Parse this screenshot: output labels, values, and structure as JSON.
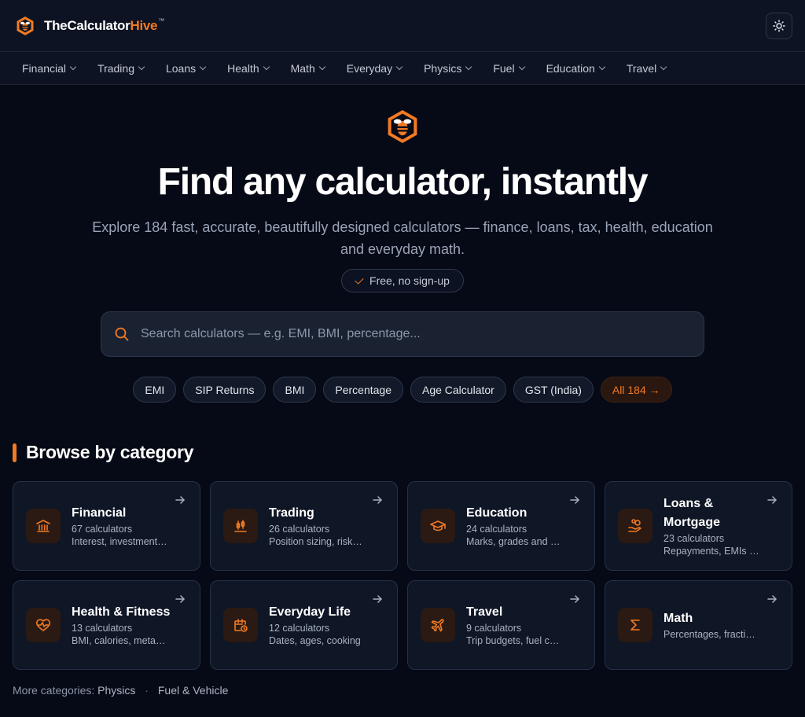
{
  "brand": {
    "name_part1": "TheCalculator",
    "name_part2": "Hive",
    "trademark": "™"
  },
  "theme_toggle_icon": "sun-icon",
  "nav": [
    {
      "label": "Financial"
    },
    {
      "label": "Trading"
    },
    {
      "label": "Loans"
    },
    {
      "label": "Health"
    },
    {
      "label": "Math"
    },
    {
      "label": "Everyday"
    },
    {
      "label": "Physics"
    },
    {
      "label": "Fuel"
    },
    {
      "label": "Education"
    },
    {
      "label": "Travel"
    }
  ],
  "hero": {
    "title": "Find any calculator, instantly",
    "subtitle": "Explore 184 fast, accurate, beautifully designed calculators — finance, loans, tax, health, education and everyday math.",
    "badge": "Free, no sign-up"
  },
  "search": {
    "placeholder": "Search calculators — e.g. EMI, BMI, percentage..."
  },
  "quick_links": [
    "EMI",
    "SIP Returns",
    "BMI",
    "Percentage",
    "Age Calculator",
    "GST (India)"
  ],
  "all_link": "All 184 →",
  "categories_section": {
    "title": "Browse by category",
    "cards": [
      {
        "title": "Financial",
        "count": "67 calculators",
        "desc": "Interest, investments, savings",
        "icon": "bank-icon"
      },
      {
        "title": "Trading",
        "count": "26 calculators",
        "desc": "Position sizing, risk and more",
        "icon": "candlestick-icon"
      },
      {
        "title": "Education",
        "count": "24 calculators",
        "desc": "Marks, grades and more",
        "icon": "graduation-cap-icon"
      },
      {
        "title": "Loans & Mortgage",
        "count": "23 calculators",
        "desc": "Repayments, EMIs and more",
        "icon": "hand-coins-icon"
      },
      {
        "title": "Health & Fitness",
        "count": "13 calculators",
        "desc": "BMI, calories, metabolism",
        "icon": "heart-pulse-icon"
      },
      {
        "title": "Everyday Life",
        "count": "12 calculators",
        "desc": "Dates, ages, cooking",
        "icon": "calendar-clock-icon"
      },
      {
        "title": "Travel",
        "count": "9 calculators",
        "desc": "Trip budgets, fuel costs",
        "icon": "plane-icon"
      },
      {
        "title": "Math",
        "count": "",
        "desc": "Percentages, fractions",
        "icon": "sigma-icon"
      }
    ]
  },
  "more_categories": {
    "label": "More categories:",
    "links": [
      "Physics",
      "Fuel & Vehicle"
    ],
    "separator": "·"
  },
  "colors": {
    "accent": "#f27a23",
    "background": "#060a16",
    "card": "#0f1626"
  }
}
